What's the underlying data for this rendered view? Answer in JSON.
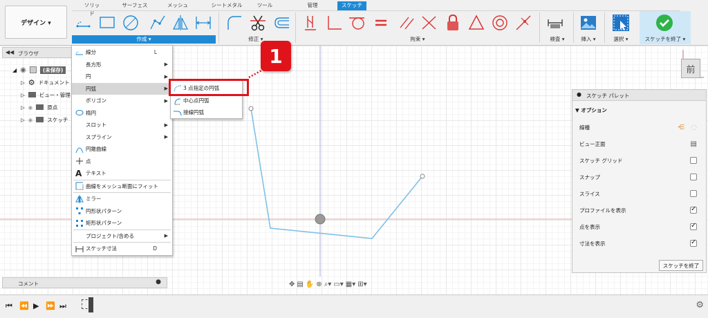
{
  "workspace": {
    "label": "デザイン ▾"
  },
  "tabs": [
    "ソリッド",
    "サーフェス",
    "メッシュ",
    "シートメタル",
    "ツール",
    "管理",
    "スケッチ"
  ],
  "active_tab": "スケッチ",
  "groups": {
    "create": "作成 ▾",
    "modify": "修正 ▾",
    "constraints": "拘束 ▾",
    "inspect": "検査 ▾",
    "insert": "挿入 ▾",
    "select": "選択 ▾",
    "finish": "スケッチを終了 ▾"
  },
  "browser": {
    "title": "ブラウザ",
    "rows": [
      "(未保存)",
      "ドキュメント",
      "ビュー・管理",
      "原点",
      "スケッチ"
    ]
  },
  "comments": {
    "title": "コメント"
  },
  "create_menu": {
    "items": [
      {
        "label": "線分",
        "shortcut": "L",
        "submenu": false
      },
      {
        "label": "長方形",
        "shortcut": "",
        "submenu": true
      },
      {
        "label": "円",
        "shortcut": "",
        "submenu": true
      },
      {
        "label": "円弧",
        "shortcut": "",
        "submenu": true
      },
      {
        "label": "ポリゴン",
        "shortcut": "",
        "submenu": true
      },
      {
        "label": "楕円",
        "shortcut": "",
        "submenu": false
      },
      {
        "label": "スロット",
        "shortcut": "",
        "submenu": true
      },
      {
        "label": "スプライン",
        "shortcut": "",
        "submenu": true
      },
      {
        "label": "円錐曲線",
        "shortcut": "",
        "submenu": false
      },
      {
        "label": "点",
        "shortcut": "",
        "submenu": false
      },
      {
        "label": "テキスト",
        "shortcut": "",
        "submenu": false
      },
      {
        "label": "曲線をメッシュ断面にフィット",
        "shortcut": "",
        "submenu": false
      },
      {
        "label": "ミラー",
        "shortcut": "",
        "submenu": false
      },
      {
        "label": "円形状パターン",
        "shortcut": "",
        "submenu": false
      },
      {
        "label": "矩形状パターン",
        "shortcut": "",
        "submenu": false
      },
      {
        "label": "プロジェクト/含める",
        "shortcut": "",
        "submenu": true
      },
      {
        "label": "スケッチ寸法",
        "shortcut": "D",
        "submenu": false
      }
    ]
  },
  "arc_submenu": {
    "items": [
      "3 点指定の円弧",
      "中心点円弧",
      "接線円弧"
    ]
  },
  "callout_number": "1",
  "view_cube": {
    "face": "前"
  },
  "palette": {
    "title": "スケッチ パレット",
    "section": "オプション",
    "rows": [
      {
        "label": "線種",
        "control": "icon",
        "checked": false
      },
      {
        "label": "ビュー正面",
        "control": "icon",
        "checked": false
      },
      {
        "label": "スケッチ グリッド",
        "control": "checkbox",
        "checked": false
      },
      {
        "label": "スナップ",
        "control": "checkbox",
        "checked": false
      },
      {
        "label": "スライス",
        "control": "checkbox",
        "checked": false
      },
      {
        "label": "プロファイルを表示",
        "control": "checkbox",
        "checked": true
      },
      {
        "label": "点を表示",
        "control": "checkbox",
        "checked": true
      },
      {
        "label": "寸法を表示",
        "control": "checkbox",
        "checked": true
      }
    ],
    "finish_button": "スケッチを終了"
  },
  "colors": {
    "accent": "#1e8ad6",
    "callout_red": "#e0131a",
    "sketch_line": "#7ec1e6",
    "finish_green": "#2fb34a"
  }
}
